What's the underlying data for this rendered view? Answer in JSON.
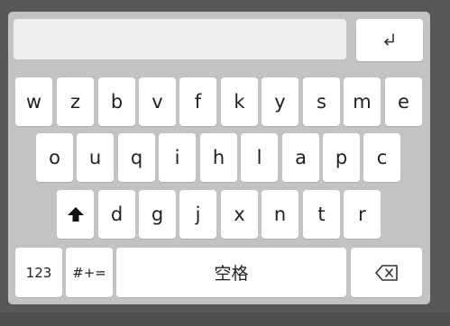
{
  "keyboard": {
    "input_value": "",
    "rows": [
      [
        "w",
        "z",
        "b",
        "v",
        "f",
        "k",
        "y",
        "s",
        "m",
        "e"
      ],
      [
        "o",
        "u",
        "q",
        "i",
        "h",
        "l",
        "a",
        "p",
        "c"
      ],
      [
        "d",
        "g",
        "j",
        "x",
        "n",
        "t",
        "r"
      ]
    ],
    "numbers_key": "123",
    "symbols_key": "#+=",
    "space_key": "空格",
    "icons": {
      "enter": "return-arrow-icon",
      "shift": "shift-arrow-up-icon",
      "backspace": "backspace-icon"
    }
  }
}
